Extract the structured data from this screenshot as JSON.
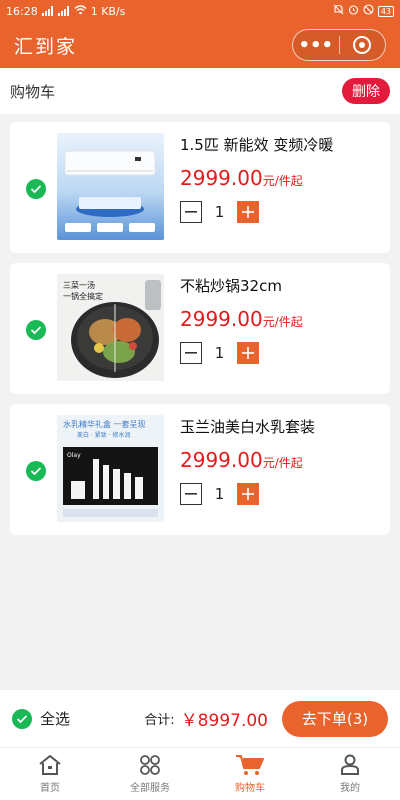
{
  "status": {
    "time": "16:28",
    "speed": "1 KB/s",
    "battery": "43"
  },
  "app": {
    "title": "汇到家"
  },
  "cart_header": {
    "title": "购物车",
    "delete_label": "删除"
  },
  "items": [
    {
      "name": "1.5匹 新能效 变频冷暖",
      "price": "2999.00",
      "unit": "元/件起",
      "qty": "1",
      "image": "air-conditioner"
    },
    {
      "name": "不粘炒锅32cm",
      "price": "2999.00",
      "unit": "元/件起",
      "qty": "1",
      "image": "wok",
      "image_text": [
        "三菜一汤",
        "一锅全搞定"
      ]
    },
    {
      "name": "玉兰油美白水乳套装",
      "price": "2999.00",
      "unit": "元/件起",
      "qty": "1",
      "image": "skincare-set",
      "image_text": [
        "水乳精华礼盒 一套呈现",
        "美白 · 紧致 · 修水润",
        "Olay"
      ]
    }
  ],
  "footer": {
    "select_all": "全选",
    "total_label": "合计:",
    "total_amount": "￥8997.00",
    "order_label": "下单(3)",
    "order_prefix": "去"
  },
  "tabs": [
    {
      "label": "首页",
      "icon": "home-icon"
    },
    {
      "label": "全部服务",
      "icon": "grid-icon"
    },
    {
      "label": "购物车",
      "icon": "cart-icon",
      "active": true
    },
    {
      "label": "我的",
      "icon": "person-icon"
    }
  ],
  "colors": {
    "brand": "#e8642c",
    "price": "#e21b1b",
    "check": "#19b955",
    "delete": "#e21b3c"
  }
}
